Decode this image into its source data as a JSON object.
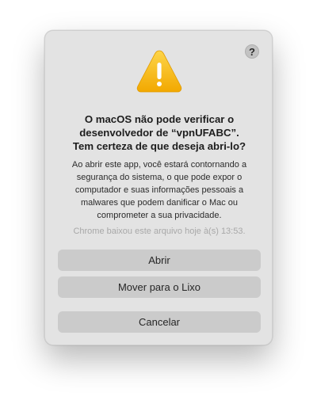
{
  "dialog": {
    "help_label": "?",
    "title": "O macOS não pode verificar o desenvolvedor de “vpnUFABC”. Tem certeza de que deseja abri-lo?",
    "message": "Ao abrir este app, você estará contornando a segurança do sistema, o que pode expor o computador e suas informações pessoais a malwares que podem danificar o Mac ou comprometer a sua privacidade.",
    "download_note": "Chrome baixou este arquivo hoje à(s) 13:53.",
    "buttons": {
      "open": "Abrir",
      "move_to_trash": "Mover para o Lixo",
      "cancel": "Cancelar"
    },
    "icon": "warning-triangle-icon"
  },
  "colors": {
    "dialog_bg": "#e3e3e3",
    "button_bg": "#cbcbcb",
    "warning_yellow": "#f7b500",
    "note_gray": "#a8a8a8"
  }
}
